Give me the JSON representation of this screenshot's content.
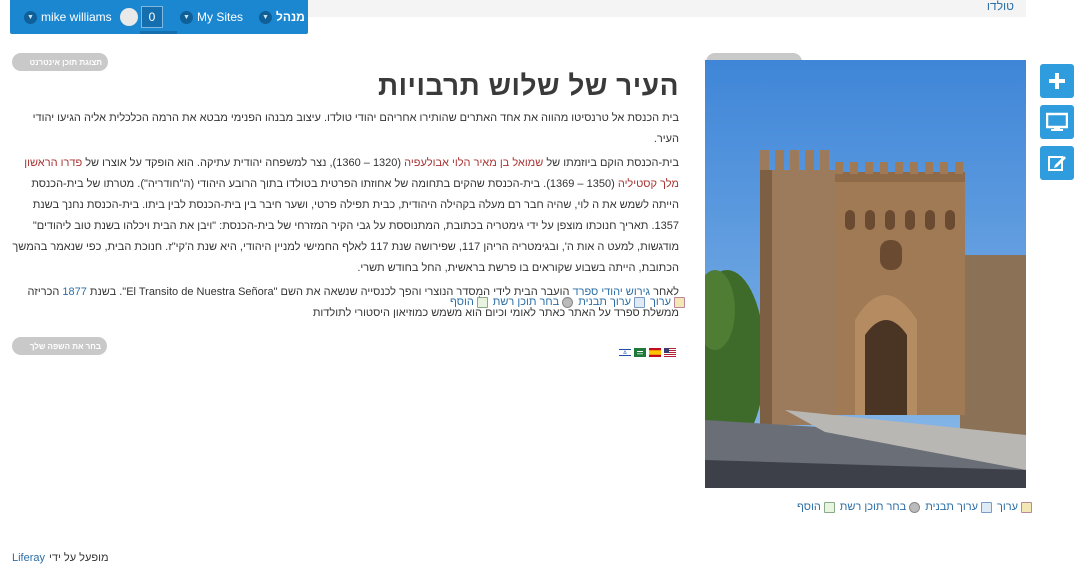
{
  "dock": {
    "user_name": "mike williams",
    "notification_count": "0",
    "my_sites": "My Sites",
    "admin": "מנהל"
  },
  "breadcrumb": "טולדו",
  "side_tools": [
    "add-icon",
    "preview-icon",
    "edit-icon"
  ],
  "portlet_pills": {
    "article_left": "תצוגת תוכן אינטרנט",
    "image_right": "תצוגת תוכן אינטרנט",
    "language": "בחר את השפה שלך"
  },
  "article": {
    "title": "העיר של שלוש תרבויות",
    "p1": "בית הכנסת אל טרנסיטו מהווה את אחד האתרים שהותירו אחריהם יהודי טולדו. עיצוב מבנהו הפנימי מבטא את הרמה הכלכלית אליה הגיעו יהודי העיר.",
    "p2_before": "בית-הכנסת הוקם ביוזמתו של ",
    "p2_link1": "שמואל בן מאיר הלוי אבולעפיה",
    "p2_mid1": " (1320 – 1360), נצר למשפחה יהודית עתיקה. הוא הופקד על אוצרו של ",
    "p2_link2": "פדרו הראשון מלך קסטיליה",
    "p2_after": " (1350 – 1369). בית-הכנסת שהקים בתחומה של אחוזתו הפרטית בטולדו בתוך הרובע היהודי (ה\"חודריה\"). מטרתו של בית-הכנסת הייתה לשמש את ה לוי, שהיה חבר רם מעלה בקהילה היהודית, כבית תפילה פרטי, ושער חיבר בין בית-הכנסת לבין ביתו. בית-הכנסת נחנך בשנת 1357. תאריך חנוכתו מוצפן על ידי גימטריה בכתובת, המתנוססת על גבי הקיר המזרחי של בית-הכנסת: \"ויבן את הבית ויכלהו בשנת טוב ליהודים\" מודגשות, למעט ה אות ה', ובגימטריה הריהן 117, שפירושה שנת 117 לאלף החמישי למניין היהודי, היא שנת ה'קי\"ז. חנוכת הבית, כפי שנאמר בהמשך הכתובת, הייתה בשבוע שקוראים בו פרשת בראשית, החל בחודש תשרי.",
    "p3_before": "לאחר ",
    "p3_link1": "גירוש יהודי ספרד",
    "p3_mid": " הועבר הבית לידי המִסדר הנוצרי והפך לכנסייה שנשאה את השם \"El Transito de Nuestra Señora\". בשנת ",
    "p3_link2": "1877",
    "p3_after": " הכריזה ממשלת ספרד על האתר כאתר לאומי וכיום הוא משמש כמוזיאון היסטורי לתולדות"
  },
  "actions": {
    "edit": "ערוך",
    "edit_template": "ערוך תבנית",
    "select_content": "בחר תוכן רשת",
    "add": "הוסף"
  },
  "flags": [
    "us-flag-icon",
    "es-flag-icon",
    "sa-flag-icon",
    "il-flag-icon"
  ],
  "footer": {
    "powered_by": "מופעל על ידי",
    "liferay": "Liferay"
  },
  "colors": {
    "dock": "#1c87d1",
    "side_button": "#2f9cdd",
    "link_blue": "#2b6ea6",
    "link_red": "#a33333"
  }
}
